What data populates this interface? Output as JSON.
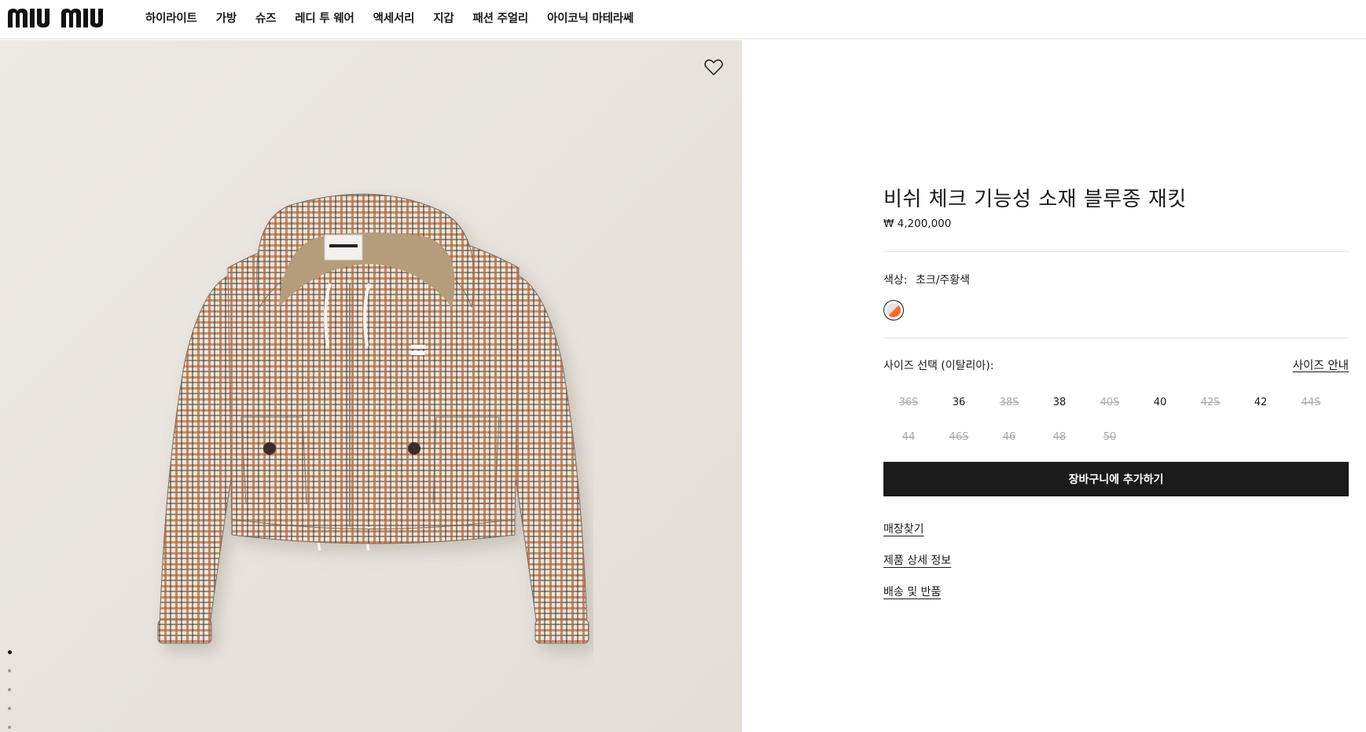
{
  "header": {
    "logo_text": "miu miu",
    "nav": [
      {
        "label": "하이라이트"
      },
      {
        "label": "가방"
      },
      {
        "label": "슈즈"
      },
      {
        "label": "레디 투 웨어"
      },
      {
        "label": "액세서리"
      },
      {
        "label": "지갑"
      },
      {
        "label": "패션 주얼리"
      },
      {
        "label": "아이코닉 마테라쎄"
      }
    ]
  },
  "gallery": {
    "image_count": 5,
    "active_index": 0,
    "background": "#e9e5df"
  },
  "product": {
    "title": "비쉬 체크 기능성 소재 블루종 재킷",
    "price": "₩ 4,200,000",
    "color_label": "색상:",
    "color_value": "초크/주황색",
    "swatch_colors": [
      "#e9e4de",
      "#ff6a2a"
    ],
    "size_label": "사이즈 선택 (이탈리아):",
    "size_guide": "사이즈 안내",
    "sizes": [
      {
        "label": "36S",
        "available": false
      },
      {
        "label": "36",
        "available": true
      },
      {
        "label": "38S",
        "available": false
      },
      {
        "label": "38",
        "available": true
      },
      {
        "label": "40S",
        "available": false
      },
      {
        "label": "40",
        "available": true
      },
      {
        "label": "42S",
        "available": false
      },
      {
        "label": "42",
        "available": true
      },
      {
        "label": "44S",
        "available": false
      },
      {
        "label": "44",
        "available": false
      },
      {
        "label": "46S",
        "available": false
      },
      {
        "label": "46",
        "available": false
      },
      {
        "label": "48",
        "available": false
      },
      {
        "label": "50",
        "available": false
      }
    ],
    "add_to_cart": "장바구니에 추가하기",
    "links": {
      "store": "매장찾기",
      "details": "제품 상세 정보",
      "shipping": "배송 및 반품"
    }
  }
}
